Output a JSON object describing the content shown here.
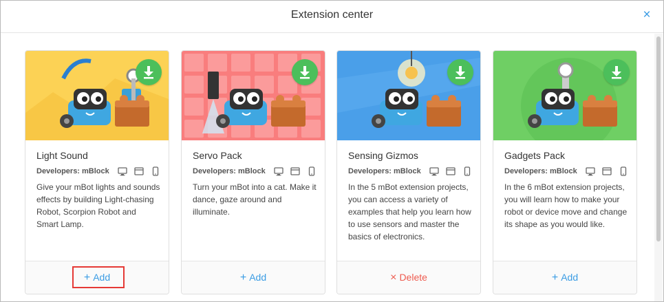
{
  "dialog": {
    "title": "Extension center",
    "close_icon": "close-icon",
    "close_glyph": "×"
  },
  "cards": [
    {
      "title": "Light Sound",
      "developers": "Developers: mBlock",
      "description": "Give your mBot lights and sounds effects by building Light-chasing Robot, Scorpion Robot and Smart Lamp.",
      "action_glyph": "+",
      "action_label": "Add",
      "action_type": "add",
      "highlighted": true,
      "image_bg": "#fcd255"
    },
    {
      "title": "Servo Pack",
      "developers": "Developers: mBlock",
      "description": "Turn your mBot into a cat. Make it dance, gaze around and illuminate.",
      "action_glyph": "+",
      "action_label": "Add",
      "action_type": "add",
      "highlighted": false,
      "image_bg": "#f97d7d"
    },
    {
      "title": "Sensing Gizmos",
      "developers": "Developers: mBlock",
      "description": "In the 5 mBot extension projects, you can access a variety of examples that help you learn how to use sensors and master the basics of electronics.",
      "action_glyph": "×",
      "action_label": "Delete",
      "action_type": "delete",
      "highlighted": false,
      "image_bg": "#4a9fe9"
    },
    {
      "title": "Gadgets Pack",
      "developers": "Developers: mBlock",
      "description": "In the 6 mBot extension projects, you will learn how to make your robot or device move and change its shape as you would like.",
      "action_glyph": "+",
      "action_label": "Add",
      "action_type": "add",
      "highlighted": false,
      "image_bg": "#6fcf64"
    }
  ],
  "platform_icons": [
    "desktop-icon",
    "browser-window-icon",
    "mobile-icon"
  ],
  "colors": {
    "accent": "#3a9ce4",
    "download_badge": "#4cbf5b",
    "delete": "#ee5b4f",
    "highlight": "#e53935"
  }
}
